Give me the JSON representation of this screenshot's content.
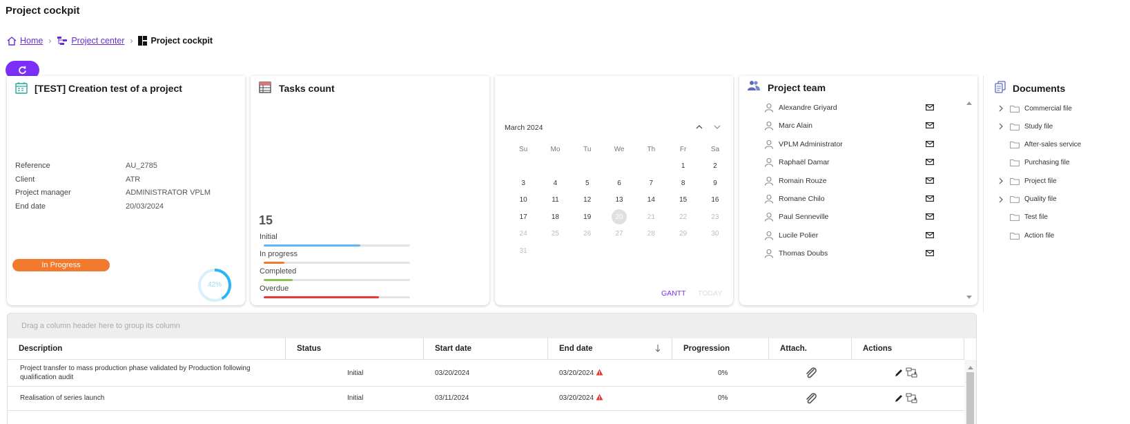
{
  "page": {
    "title": "Project cockpit"
  },
  "breadcrumb": {
    "home": "Home",
    "project_center": "Project center",
    "current": "Project cockpit"
  },
  "project": {
    "title": "[TEST] Creation test of a project",
    "fields": [
      {
        "label": "Reference",
        "value": "AU_2785"
      },
      {
        "label": "Client",
        "value": "ATR"
      },
      {
        "label": "Project manager",
        "value": "ADMINISTRATOR VPLM"
      },
      {
        "label": "End date",
        "value": "20/03/2024"
      }
    ],
    "status": "In Progress",
    "status_color": "#f27a2e",
    "progress": "42%",
    "progress_value": 0.42
  },
  "tasks": {
    "title": "Tasks count",
    "total": "15",
    "items": [
      {
        "label": "Initial",
        "fraction": 0.66,
        "color": "#64b5f6"
      },
      {
        "label": "In progress",
        "fraction": 0.14,
        "color": "#f27a2e"
      },
      {
        "label": "Completed",
        "fraction": 0.2,
        "color": "#8bc34a"
      },
      {
        "label": "Overdue",
        "fraction": 0.79,
        "color": "#e53935"
      }
    ]
  },
  "calendar": {
    "month": "March 2024",
    "weekdays": [
      "Su",
      "Mo",
      "Tu",
      "We",
      "Th",
      "Fr",
      "Sa"
    ],
    "days": [
      "",
      "",
      "",
      "",
      "",
      "1",
      "2",
      "3",
      "4",
      "5",
      "6",
      "7",
      "8",
      "9",
      "10",
      "11",
      "12",
      "13",
      "14",
      "15",
      "16",
      "17",
      "18",
      "19",
      "20",
      "21",
      "22",
      "23",
      "24",
      "25",
      "26",
      "27",
      "28",
      "29",
      "30",
      "31"
    ],
    "selected": "20",
    "enabled_until": 19,
    "gantt_label": "GANTT",
    "today_label": "TODAY"
  },
  "team": {
    "title": "Project team",
    "members": [
      "Alexandre Griyard",
      "Marc Alain",
      "VPLM Administrator",
      "Raphaël Damar",
      "Romain Rouze",
      "Romane Chilo",
      "Paul Senneville",
      "Lucile Polier",
      "Thomas Doubs"
    ]
  },
  "documents": {
    "title": "Documents",
    "items": [
      {
        "label": "Commercial file",
        "expandable": true
      },
      {
        "label": "Study file",
        "expandable": true
      },
      {
        "label": "After-sales service",
        "expandable": false
      },
      {
        "label": "Purchasing file",
        "expandable": false
      },
      {
        "label": "Project file",
        "expandable": true
      },
      {
        "label": "Quality file",
        "expandable": true
      },
      {
        "label": "Test file",
        "expandable": false
      },
      {
        "label": "Action file",
        "expandable": false
      }
    ]
  },
  "grid": {
    "group_hint": "Drag a column header here to group its column",
    "columns": [
      "Description",
      "Status",
      "Start date",
      "End date",
      "Progression",
      "Attach.",
      "Actions"
    ],
    "sort_icon": "arrow-down-icon",
    "rows": [
      {
        "description": "Project transfer to mass production phase validated by Production following qualification audit",
        "status": "Initial",
        "start": "03/20/2024",
        "end": "03/20/2024",
        "progression": "0%"
      },
      {
        "description": "Realisation of series launch",
        "status": "Initial",
        "start": "03/11/2024",
        "end": "03/20/2024",
        "progression": "0%"
      }
    ]
  },
  "colors": {
    "accent": "#7b2ff7",
    "link": "#6b2bd9",
    "warning": "#e53935"
  }
}
